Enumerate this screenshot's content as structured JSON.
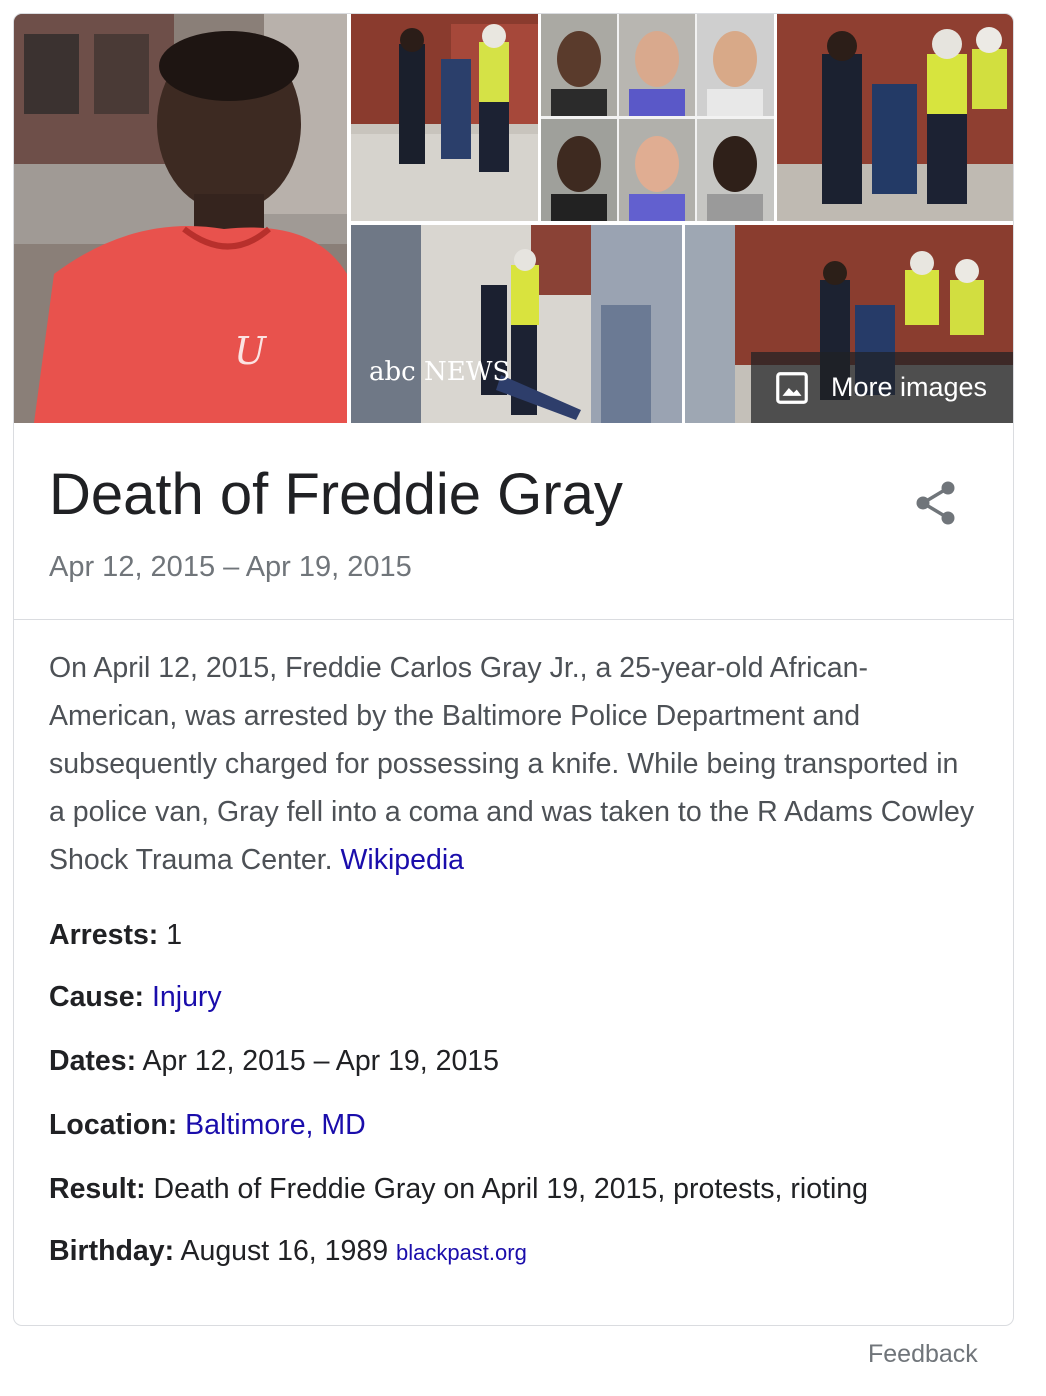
{
  "gallery": {
    "more_images_label": "More images",
    "news_watermark": "abc NEWS",
    "icons": {
      "more_images": "image-icon",
      "share": "share-icon"
    },
    "colors": {
      "overlay": "#202124",
      "accent_link": "#1a0dab"
    }
  },
  "header": {
    "title": "Death of Freddie Gray",
    "date_range": "Apr 12, 2015 – Apr 19, 2015"
  },
  "description": {
    "text": "On April 12, 2015, Freddie Carlos Gray Jr., a 25-year-old African-American, was arrested by the Baltimore Police Department and subsequently charged for possessing a knife. While being transported in a police van, Gray fell into a coma and was taken to the R Adams Cowley Shock Trauma Center.",
    "source_link": "Wikipedia"
  },
  "facts": [
    {
      "key": "Arrests:",
      "value": "1",
      "is_link": false
    },
    {
      "key": "Cause:",
      "value": "Injury",
      "is_link": true
    },
    {
      "key": "Dates:",
      "value": "Apr 12, 2015 – Apr 19, 2015",
      "is_link": false
    },
    {
      "key": "Location:",
      "value": "Baltimore, MD",
      "is_link": true
    },
    {
      "key": "Result:",
      "value": "Death of Freddie Gray on April 19, 2015, protests, rioting",
      "is_link": false
    },
    {
      "key": "Birthday:",
      "value": "August 16, 1989",
      "is_link": false,
      "source": "blackpast.org"
    }
  ],
  "footer": {
    "feedback_label": "Feedback"
  }
}
